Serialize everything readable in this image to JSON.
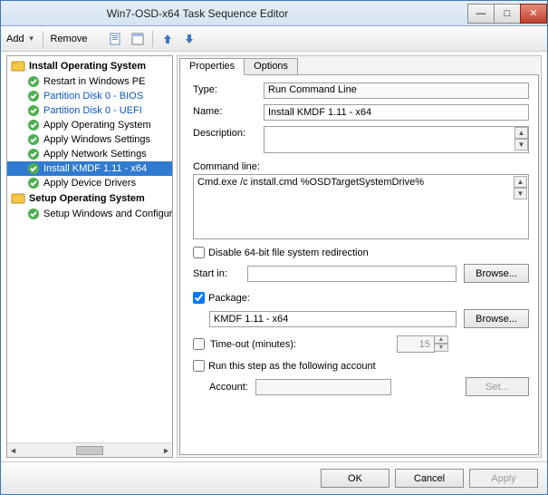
{
  "window": {
    "title": "Win7-OSD-x64 Task Sequence Editor"
  },
  "toolbar": {
    "add": "Add",
    "remove": "Remove"
  },
  "tree": {
    "group1": {
      "label": "Install Operating System",
      "items": [
        "Restart in Windows PE",
        "Partition Disk 0 - BIOS",
        "Partition Disk 0 - UEFI",
        "Apply Operating System",
        "Apply Windows Settings",
        "Apply Network Settings",
        "Install KMDF 1.11 - x64",
        "Apply Device Drivers"
      ]
    },
    "group2": {
      "label": "Setup Operating System",
      "items": [
        "Setup Windows and Configuration"
      ]
    }
  },
  "tabs": {
    "properties": "Properties",
    "options": "Options"
  },
  "form": {
    "type_label": "Type:",
    "type_value": "Run Command Line",
    "name_label": "Name:",
    "name_value": "Install KMDF 1.11 - x64",
    "desc_label": "Description:",
    "desc_value": "",
    "cmd_label": "Command line:",
    "cmd_value": "Cmd.exe /c install.cmd %OSDTargetSystemDrive%",
    "disable64": "Disable 64-bit file system redirection",
    "startin_label": "Start in:",
    "startin_value": "",
    "browse": "Browse...",
    "package_label": "Package:",
    "package_value": "KMDF 1.11 - x64",
    "timeout_label": "Time-out (minutes):",
    "timeout_value": "15",
    "runas_label": "Run this step as the following account",
    "account_label": "Account:",
    "account_value": "",
    "set_btn": "Set..."
  },
  "footer": {
    "ok": "OK",
    "cancel": "Cancel",
    "apply": "Apply"
  }
}
